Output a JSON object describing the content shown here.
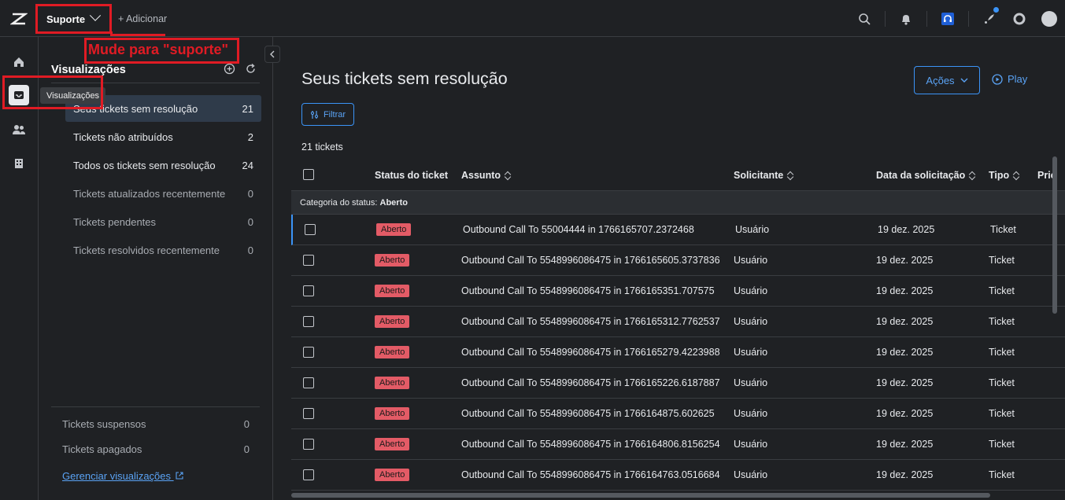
{
  "topbar": {
    "product": "Suporte",
    "add_label": "+ Adicionar",
    "icons": [
      "search-icon",
      "bell-icon",
      "headset-icon",
      "rocket-icon",
      "help-icon",
      "avatar"
    ]
  },
  "rail": {
    "items": [
      "home-icon",
      "views-icon",
      "users-icon",
      "organizations-icon"
    ],
    "tooltip": "Visualizações"
  },
  "annotation": {
    "text": "Mude para \"suporte\""
  },
  "views": {
    "title": "Visualizações",
    "items": [
      {
        "label": "Seus tickets sem resolução",
        "count": "21",
        "active": true
      },
      {
        "label": "Tickets não atribuídos",
        "count": "2",
        "active": false
      },
      {
        "label": "Todos os tickets sem resolução",
        "count": "24",
        "active": false
      },
      {
        "label": "Tickets atualizados recentemente",
        "count": "0",
        "active": false
      },
      {
        "label": "Tickets pendentes",
        "count": "0",
        "active": false
      },
      {
        "label": "Tickets resolvidos recentemente",
        "count": "0",
        "active": false
      }
    ],
    "bottom": [
      {
        "label": "Tickets suspensos",
        "count": "0"
      },
      {
        "label": "Tickets apagados",
        "count": "0"
      }
    ],
    "manage_link": "Gerenciar visualizações"
  },
  "main": {
    "title": "Seus tickets sem resolução",
    "actions_label": "Ações",
    "play_label": "Play",
    "filter_label": "Filtrar",
    "count_label": "21 tickets",
    "columns": [
      "Status do ticket",
      "Assunto",
      "Solicitante",
      "Data da solicitação",
      "Tipo",
      "Prio"
    ],
    "group_label": "Categoria do status:",
    "group_value": "Aberto",
    "rows": [
      {
        "status": "Aberto",
        "subject": "Outbound Call To 55004444 in 1766165707.2372468",
        "requester": "Usuário",
        "date": "19 dez. 2025",
        "type": "Ticket"
      },
      {
        "status": "Aberto",
        "subject": "Outbound Call To 5548996086475 in 1766165605.3737836",
        "requester": "Usuário",
        "date": "19 dez. 2025",
        "type": "Ticket"
      },
      {
        "status": "Aberto",
        "subject": "Outbound Call To 5548996086475 in 1766165351.707575",
        "requester": "Usuário",
        "date": "19 dez. 2025",
        "type": "Ticket"
      },
      {
        "status": "Aberto",
        "subject": "Outbound Call To 5548996086475 in 1766165312.7762537",
        "requester": "Usuário",
        "date": "19 dez. 2025",
        "type": "Ticket"
      },
      {
        "status": "Aberto",
        "subject": "Outbound Call To 5548996086475 in 1766165279.4223988",
        "requester": "Usuário",
        "date": "19 dez. 2025",
        "type": "Ticket"
      },
      {
        "status": "Aberto",
        "subject": "Outbound Call To 5548996086475 in 1766165226.6187887",
        "requester": "Usuário",
        "date": "19 dez. 2025",
        "type": "Ticket"
      },
      {
        "status": "Aberto",
        "subject": "Outbound Call To 5548996086475 in 1766164875.602625",
        "requester": "Usuário",
        "date": "19 dez. 2025",
        "type": "Ticket"
      },
      {
        "status": "Aberto",
        "subject": "Outbound Call To 5548996086475 in 1766164806.8156254",
        "requester": "Usuário",
        "date": "19 dez. 2025",
        "type": "Ticket"
      },
      {
        "status": "Aberto",
        "subject": "Outbound Call To 5548996086475 in 1766164763.0516684",
        "requester": "Usuário",
        "date": "19 dez. 2025",
        "type": "Ticket"
      }
    ]
  },
  "colors": {
    "accent": "#3b94f7",
    "badge_open": "#e35b66",
    "annotation": "#e01b24"
  }
}
